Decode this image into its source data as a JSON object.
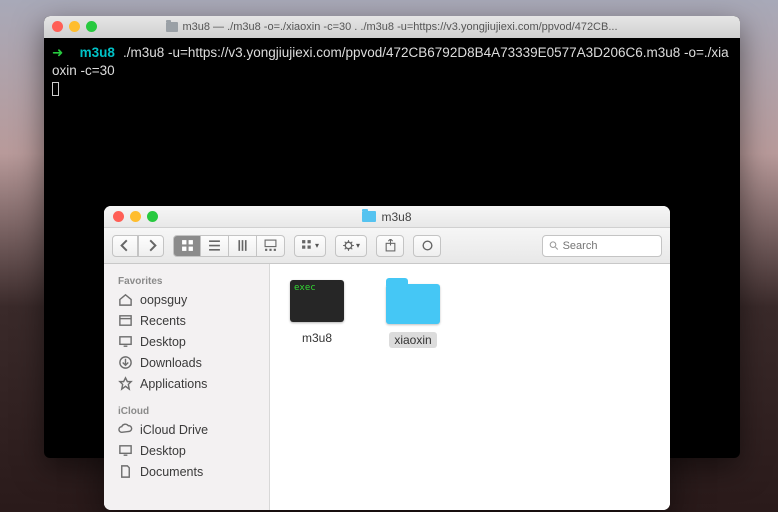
{
  "terminal": {
    "title": "m3u8 — ./m3u8 -o=./xiaoxin -c=30 . ./m3u8 -u=https://v3.yongjiujiexi.com/ppvod/472CB...",
    "prompt_arrow": "➜",
    "prompt_dir": "m3u8",
    "command": "./m3u8 -u=https://v3.yongjiujiexi.com/ppvod/472CB6792D8B4A73339E0577A3D206C6.m3u8 -o=./xiaoxin -c=30"
  },
  "finder": {
    "title": "m3u8",
    "search_placeholder": "Search",
    "sidebar": {
      "sections": [
        {
          "header": "Favorites",
          "items": [
            {
              "label": "oopsguy",
              "icon": "home"
            },
            {
              "label": "Recents",
              "icon": "recents"
            },
            {
              "label": "Desktop",
              "icon": "desktop"
            },
            {
              "label": "Downloads",
              "icon": "downloads"
            },
            {
              "label": "Applications",
              "icon": "apps"
            }
          ]
        },
        {
          "header": "iCloud",
          "items": [
            {
              "label": "iCloud Drive",
              "icon": "cloud"
            },
            {
              "label": "Desktop",
              "icon": "desktop"
            },
            {
              "label": "Documents",
              "icon": "documents"
            }
          ]
        }
      ]
    },
    "files": [
      {
        "name": "m3u8",
        "type": "exec",
        "selected": false
      },
      {
        "name": "xiaoxin",
        "type": "folder",
        "selected": true
      }
    ]
  }
}
